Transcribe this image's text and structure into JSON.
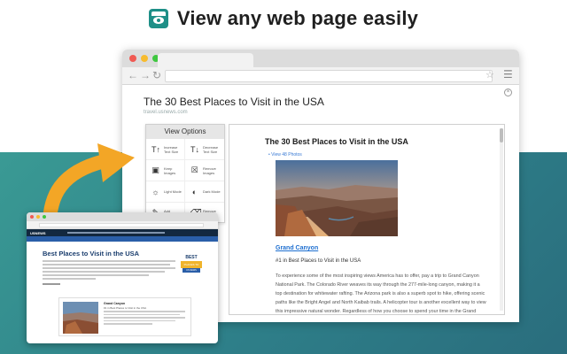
{
  "headline": {
    "text": "View any web page easily",
    "icon": "reader-eye-icon"
  },
  "colors": {
    "accent": "#f3a626",
    "background_teal": "#2e7f89",
    "logo": "#1e8f87",
    "link": "#1e6fd0"
  },
  "browser": {
    "reader": {
      "title": "The 30 Best Places to Visit in the USA",
      "url": "travel.usnews.com"
    },
    "options": {
      "title": "View Options",
      "items": [
        {
          "label": "Increase Text Size",
          "icon": "increase-text-icon"
        },
        {
          "label": "Decrease Text Size",
          "icon": "decrease-text-icon"
        },
        {
          "label": "Keep Images",
          "icon": "image-icon"
        },
        {
          "label": "Remove Images",
          "icon": "remove-image-icon"
        },
        {
          "label": "Light Mode",
          "icon": "sun-icon"
        },
        {
          "label": "Dark Mode",
          "icon": "moon-icon"
        },
        {
          "label": "Add Highlight",
          "icon": "highlighter-icon"
        },
        {
          "label": "Remove Highlight",
          "icon": "erase-highlight-icon"
        }
      ]
    },
    "article": {
      "title": "The 30 Best Places to Visit in the USA",
      "photos_link": "View 48 Photos",
      "heading": "Grand Canyon",
      "rank": "#1 in Best Places to Visit in the USA",
      "body": "To experience some of the most inspiring views America has to offer, pay a trip to Grand Canyon National Park. The Colorado River weaves its way through the 277-mile-long canyon, making it a top destination for whitewater rafting. The Arizona park is also a superb spot to hike, offering scenic paths like the Bright Angel and North Kaibab trails. A helicopter tour is another excellent way to view this impressive natural wonder. Regardless of how you choose to spend your time in the Grand Canyon, you're sure to feel small"
    }
  },
  "small_browser": {
    "logo": "USNEWS",
    "title": "Best Places to Visit in the USA",
    "badge_top": "BEST",
    "badge_mid": "PLACES TO VISIT",
    "badge_bottom": "US NEWS",
    "card_title": "Grand Canyon",
    "card_subtitle": "#1 in Best Places to Visit in the USA"
  }
}
